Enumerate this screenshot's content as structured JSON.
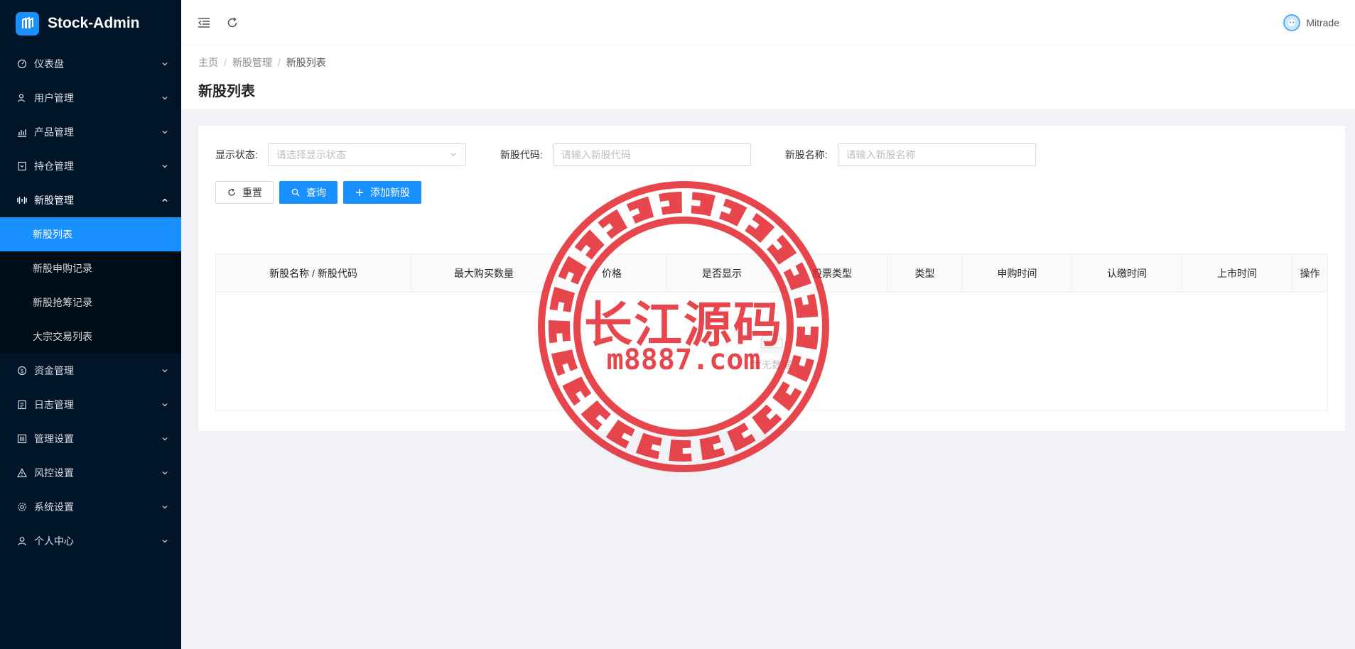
{
  "app": {
    "title": "Stock-Admin"
  },
  "sidebar": {
    "items": [
      {
        "label": "仪表盘",
        "icon": "dashboard-icon"
      },
      {
        "label": "用户管理",
        "icon": "user-group-icon"
      },
      {
        "label": "产品管理",
        "icon": "bar-chart-icon"
      },
      {
        "label": "持仓管理",
        "icon": "position-icon"
      },
      {
        "label": "新股管理",
        "icon": "new-stock-icon",
        "open": true
      },
      {
        "label": "资金管理",
        "icon": "money-icon"
      },
      {
        "label": "日志管理",
        "icon": "log-icon"
      },
      {
        "label": "管理设置",
        "icon": "admin-settings-icon"
      },
      {
        "label": "风控设置",
        "icon": "warning-icon"
      },
      {
        "label": "系统设置",
        "icon": "gear-icon"
      },
      {
        "label": "个人中心",
        "icon": "person-icon"
      }
    ],
    "submenu": [
      {
        "label": "新股列表",
        "active": true
      },
      {
        "label": "新股申购记录"
      },
      {
        "label": "新股抢筹记录"
      },
      {
        "label": "大宗交易列表"
      }
    ]
  },
  "header": {
    "username": "Mitrade"
  },
  "breadcrumb": {
    "home": "主页",
    "parent": "新股管理",
    "current": "新股列表"
  },
  "page_title": "新股列表",
  "filters": {
    "status_label": "显示状态:",
    "status_placeholder": "请选择显示状态",
    "code_label": "新股代码:",
    "code_placeholder": "请输入新股代码",
    "name_label": "新股名称:",
    "name_placeholder": "请输入新股名称"
  },
  "buttons": {
    "reset": "重置",
    "search": "查询",
    "add": "添加新股"
  },
  "table": {
    "columns": [
      "新股名称 / 新股代码",
      "最大购买数量",
      "价格",
      "是否显示",
      "股票类型",
      "类型",
      "申购时间",
      "认缴时间",
      "上市时间",
      "操作"
    ],
    "empty_text": "暂无数据"
  },
  "watermark": {
    "line1": "长江源码",
    "line2": "m8887.com"
  },
  "colors": {
    "sidebar_bg": "#001529",
    "accent": "#1890ff",
    "seal": "#e3262f"
  }
}
